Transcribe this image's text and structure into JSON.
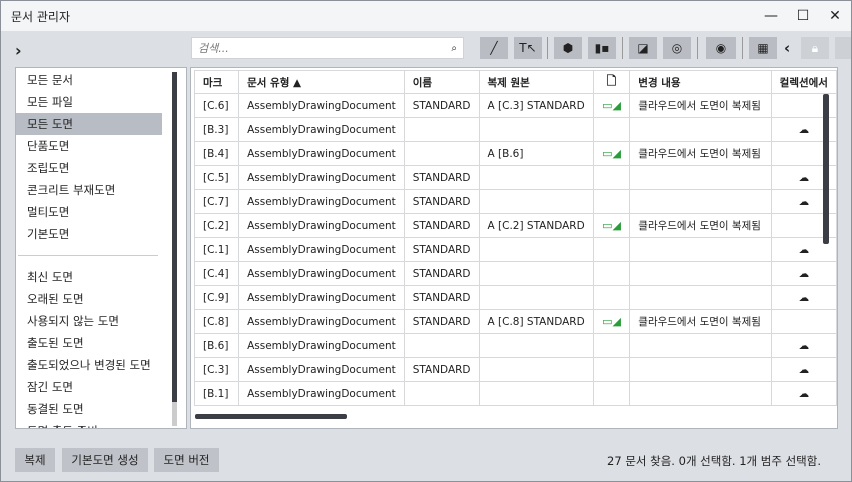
{
  "window": {
    "title": "문서 관리자",
    "min": "—",
    "max": "☐",
    "close": "✕"
  },
  "expand": "›",
  "search": {
    "placeholder": "검색...",
    "icon": "🔍"
  },
  "toolbar": {
    "collapse": "‹"
  },
  "left_items": [
    "모든 문서",
    "모든 파일",
    "모든 도면",
    "단품도면",
    "조립도면",
    "콘크리트 부재도면",
    "멀티도면",
    "기본도면"
  ],
  "left_items2": [
    "최신 도면",
    "오래된 도면",
    "사용되지 않는 도면",
    "출도된 도면",
    "출도되었으나 변경된 도면",
    "잠긴 도면",
    "동결된 도면",
    "도면 출도 준비"
  ],
  "columns": [
    "마크",
    "문서 유형 ▲",
    "이름",
    "복제 원본",
    "",
    "변경 내용",
    "컬렉션에서"
  ],
  "rows": [
    [
      "[C.6]",
      "AssemblyDrawingDocument",
      "STANDARD",
      "A   [C.3] STANDARD",
      "doc",
      "클라우드에서 도면이 복제됨",
      ""
    ],
    [
      "[B.3]",
      "AssemblyDrawingDocument",
      "",
      "",
      "",
      "",
      "cloud"
    ],
    [
      "[B.4]",
      "AssemblyDrawingDocument",
      "",
      "A   [B.6]",
      "doc",
      "클라우드에서 도면이 복제됨",
      ""
    ],
    [
      "[C.5]",
      "AssemblyDrawingDocument",
      "STANDARD",
      "",
      "",
      "",
      "cloud"
    ],
    [
      "[C.7]",
      "AssemblyDrawingDocument",
      "STANDARD",
      "",
      "",
      "",
      "cloud"
    ],
    [
      "[C.2]",
      "AssemblyDrawingDocument",
      "STANDARD",
      "A   [C.2] STANDARD",
      "doc",
      "클라우드에서 도면이 복제됨",
      ""
    ],
    [
      "[C.1]",
      "AssemblyDrawingDocument",
      "STANDARD",
      "",
      "",
      "",
      "cloud"
    ],
    [
      "[C.4]",
      "AssemblyDrawingDocument",
      "STANDARD",
      "",
      "",
      "",
      "cloud"
    ],
    [
      "[C.9]",
      "AssemblyDrawingDocument",
      "STANDARD",
      "",
      "",
      "",
      "cloud"
    ],
    [
      "[C.8]",
      "AssemblyDrawingDocument",
      "STANDARD",
      "A   [C.8] STANDARD",
      "doc",
      "클라우드에서 도면이 복제됨",
      ""
    ],
    [
      "[B.6]",
      "AssemblyDrawingDocument",
      "",
      "",
      "",
      "",
      "cloud"
    ],
    [
      "[C.3]",
      "AssemblyDrawingDocument",
      "STANDARD",
      "",
      "",
      "",
      "cloud"
    ],
    [
      "[B.1]",
      "AssemblyDrawingDocument",
      "",
      "",
      "",
      "",
      "cloud"
    ]
  ],
  "buttons": {
    "copy": "복제",
    "create_base": "기본도면 생성",
    "version": "도면 버전"
  },
  "status": "27 문서 찾음. 0개 선택함. 1개 범주 선택함."
}
